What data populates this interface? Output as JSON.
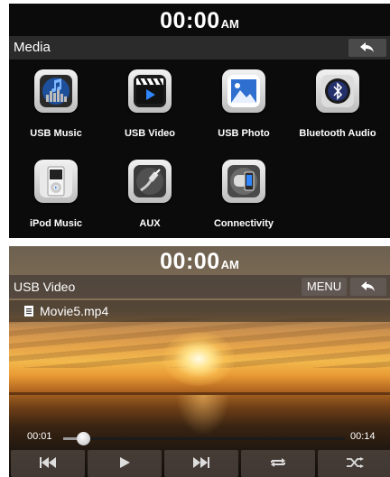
{
  "screen1": {
    "clock": {
      "time": "00:00",
      "ampm": "AM"
    },
    "title": "Media",
    "back_icon": "back-arrow-icon",
    "tiles": [
      {
        "label": "USB Music",
        "icon": "usb-music-icon"
      },
      {
        "label": "USB Video",
        "icon": "usb-video-icon"
      },
      {
        "label": "USB Photo",
        "icon": "usb-photo-icon"
      },
      {
        "label": "Bluetooth Audio",
        "icon": "bluetooth-audio-icon"
      },
      {
        "label": "iPod Music",
        "icon": "ipod-icon"
      },
      {
        "label": "AUX",
        "icon": "aux-cable-icon"
      },
      {
        "label": "Connectivity",
        "icon": "connectivity-icon"
      }
    ]
  },
  "screen2": {
    "clock": {
      "time": "00:00",
      "ampm": "AM"
    },
    "title": "USB Video",
    "menu_label": "MENU",
    "back_icon": "back-arrow-icon",
    "file_name": "Movie5.mp4",
    "file_icon": "file-list-icon",
    "elapsed": "00:01",
    "duration": "00:14",
    "progress_fraction": 0.07,
    "controls": [
      "previous-icon",
      "play-icon",
      "next-icon",
      "repeat-icon",
      "shuffle-icon"
    ]
  },
  "colors": {
    "panel_bg": "#0b0b0b",
    "bar": "#2b2b2b",
    "text": "#ffffff"
  }
}
